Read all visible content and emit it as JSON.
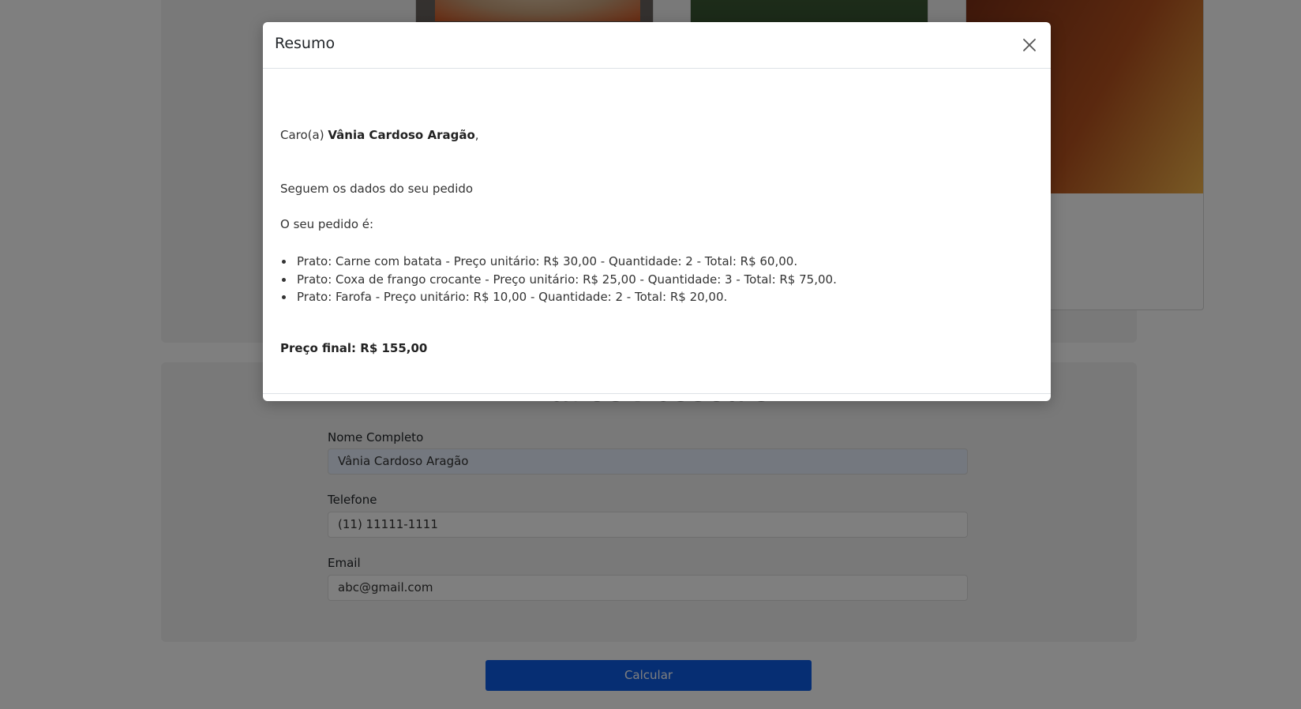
{
  "background": {
    "personal_section": {
      "title": "Dados Pessoais",
      "fields": [
        {
          "label": "Nome Completo",
          "value": "Vânia Cardoso Aragão"
        },
        {
          "label": "Telefone",
          "value": "(11) 11111-1111"
        },
        {
          "label": "Email",
          "value": "abc@gmail.com"
        }
      ]
    },
    "calculate_button": "Calcular"
  },
  "modal": {
    "title": "Resumo",
    "greeting_prefix": "Caro(a)",
    "customer_name": "Vânia Cardoso Aragão",
    "greeting_suffix": ",",
    "intro": "Seguem os dados do seu pedido",
    "order_heading": "O seu pedido é:",
    "items": [
      "Prato: Carne com batata - Preço unitário: R$ 30,00 - Quantidade: 2 - Total: R$ 60,00.",
      "Prato: Coxa de frango crocante - Preço unitário: R$ 25,00 - Quantidade: 3 - Total: R$ 75,00.",
      "Prato: Farofa - Preço unitário: R$ 10,00 - Quantidade: 2 - Total: R$ 20,00."
    ],
    "final_price": "Preço final: R$ 155,00",
    "close_icon": "close-icon"
  },
  "colors": {
    "primary_button": "#0d5ce6",
    "backdrop": "rgba(0,0,0,0.5)"
  }
}
